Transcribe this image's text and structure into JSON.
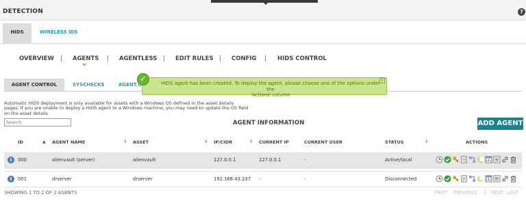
{
  "header": {
    "section_title": "DETECTION",
    "help_glyph": "?"
  },
  "top_tabs": [
    {
      "label": "HIDS",
      "active": true
    },
    {
      "label": "WIRELESS IDS",
      "active": false
    }
  ],
  "main_nav": {
    "items": [
      "OVERVIEW",
      "AGENTS",
      "AGENTLESS",
      "EDIT RULES",
      "CONFIG",
      "HIDS CONTROL"
    ],
    "separator": "|",
    "active": "AGENTS"
  },
  "sub_tabs": [
    {
      "label": "AGENT CONTROL",
      "active": true
    },
    {
      "label": "SYSCHECKS",
      "active": false
    },
    {
      "label": "AGENT.CO",
      "active": false
    }
  ],
  "toast": {
    "line1": "HIDS agent has been created. To deploy the agent, please choose one of the options under the",
    "line2": "'Actions' column",
    "ok_glyph": "✓",
    "close_glyph": "x"
  },
  "notice": {
    "line1": "Automatic HIDS deployment is only available for assets with a Windows OS defined in the asset details",
    "line2": "pages. If you are unable to deploy a HIDS agent to a Windows machine, you may need to update the OS field",
    "line3": "on the asset details."
  },
  "search": {
    "placeholder": "Search"
  },
  "table": {
    "title": "AGENT INFORMATION",
    "add_button": "ADD AGENT",
    "columns": [
      "ID",
      "AGENT NAME",
      "ASSET",
      "IP/CIDR",
      "CURRENT IP",
      "CURRENT USER",
      "STATUS",
      "ACTIONS"
    ],
    "rows": [
      {
        "id": "000",
        "name": "alienvault (server)",
        "asset": "alienvault",
        "cidr": "127.0.0.1",
        "current_ip": "127.0.0.1",
        "current_user": "-",
        "status": "Active/local"
      },
      {
        "id": "001",
        "name": "drserver",
        "asset": "drserver",
        "cidr": "192.168.43.237",
        "current_ip": "-",
        "current_user": "-",
        "status": "Disconnected"
      }
    ],
    "action_icons": [
      "clock-icon",
      "check-icon",
      "key-icon",
      "document-icon",
      "network-icon",
      "moon-icon",
      "chart-icon",
      "list-icon",
      "link-icon",
      "trash-icon"
    ]
  },
  "footer": {
    "count_text": "SHOWING 1 TO 2 OF 2 AGENTS",
    "first": "FIRST",
    "previous": "PREVIOUS",
    "page": "1",
    "next": "NEXT",
    "last": "LAST"
  },
  "colors": {
    "accent": "#1a9fc6",
    "add_button": "#17868f",
    "toast_bg": "#c9e48d",
    "ok_green": "#6ab82c"
  }
}
